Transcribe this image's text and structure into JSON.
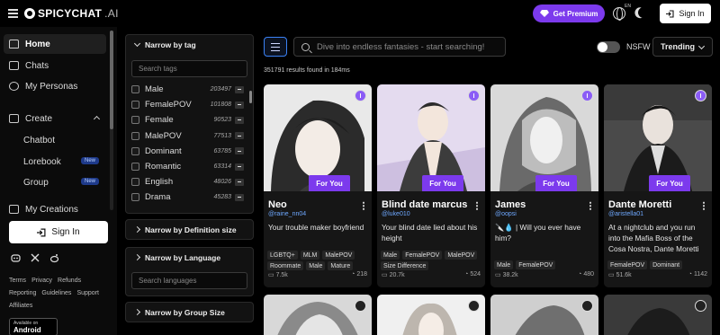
{
  "app": {
    "logo_text": "SPICYCHAT",
    "logo_suffix": ".AI"
  },
  "header": {
    "premium_label": "Get Premium",
    "lang": "EN",
    "signin_label": "Sign In"
  },
  "sidebar": {
    "items": [
      {
        "label": "Home",
        "icon": "home-icon"
      },
      {
        "label": "Chats",
        "icon": "chat-icon"
      },
      {
        "label": "My Personas",
        "icon": "persona-icon"
      },
      {
        "label": "Create",
        "icon": "plus-square-icon"
      }
    ],
    "create_items": [
      {
        "label": "Chatbot",
        "badge": ""
      },
      {
        "label": "Lorebook",
        "badge": "New"
      },
      {
        "label": "Group",
        "badge": "New"
      }
    ],
    "cut_item": "My Creations",
    "signin_label": "Sign In",
    "footer_links_row1": [
      "Terms",
      "Privacy",
      "Refunds"
    ],
    "footer_links_row2": [
      "Reporting",
      "Guidelines",
      "Support"
    ],
    "footer_links_row3": [
      "Affiliates"
    ],
    "android": {
      "small": "Available on",
      "big": "Android"
    }
  },
  "filters": {
    "tag_title": "Narrow by tag",
    "tag_search_placeholder": "Search tags",
    "tags": [
      {
        "name": "Male",
        "count": "203497"
      },
      {
        "name": "FemalePOV",
        "count": "101808"
      },
      {
        "name": "Female",
        "count": "90523"
      },
      {
        "name": "MalePOV",
        "count": "77513"
      },
      {
        "name": "Dominant",
        "count": "63785"
      },
      {
        "name": "Romantic",
        "count": "63314"
      },
      {
        "name": "English",
        "count": "48026"
      },
      {
        "name": "Drama",
        "count": "45283"
      }
    ],
    "definition_title": "Narrow by Definition size",
    "language_title": "Narrow by Language",
    "language_placeholder": "Search languages",
    "group_title": "Narrow by Group Size"
  },
  "main": {
    "search_placeholder": "Dive into endless fantasies - start searching!",
    "nsfw_label": "NSFW",
    "sort_value": "Trending",
    "results_text": "351791 results found in 184ms",
    "badge_label": "For You",
    "cards": [
      {
        "name": "Neo",
        "creator": "@raine_nn04",
        "desc": "Your trouble maker boyfriend",
        "tags": [
          "LGBTQ+",
          "MLM",
          "MalePOV",
          "Roommate",
          "Male",
          "Mature"
        ],
        "messages": "7.5k",
        "bots": "218"
      },
      {
        "name": "Blind date marcus",
        "creator": "@luke010",
        "desc": "Your blind date lied about his height",
        "tags": [
          "Male",
          "FemalePOV",
          "MalePOV",
          "Size Difference"
        ],
        "messages": "20.7k",
        "bots": "524"
      },
      {
        "name": "James",
        "creator": "@oopsi",
        "desc": "🔪💧 | Will you ever have him?",
        "tags": [
          "Male",
          "FemalePOV"
        ],
        "messages": "38.2k",
        "bots": "480"
      },
      {
        "name": "Dante Moretti",
        "creator": "@aristella01",
        "desc": "At a nightclub and you run into the Mafia Boss of the Cosa Nostra, Dante Moretti",
        "tags": [
          "FemalePOV",
          "Dominant"
        ],
        "messages": "51.6k",
        "bots": "1142"
      }
    ]
  },
  "colors": {
    "accent": "#7c3aed",
    "link": "#6ea8ff",
    "focus": "#3b82f6"
  }
}
